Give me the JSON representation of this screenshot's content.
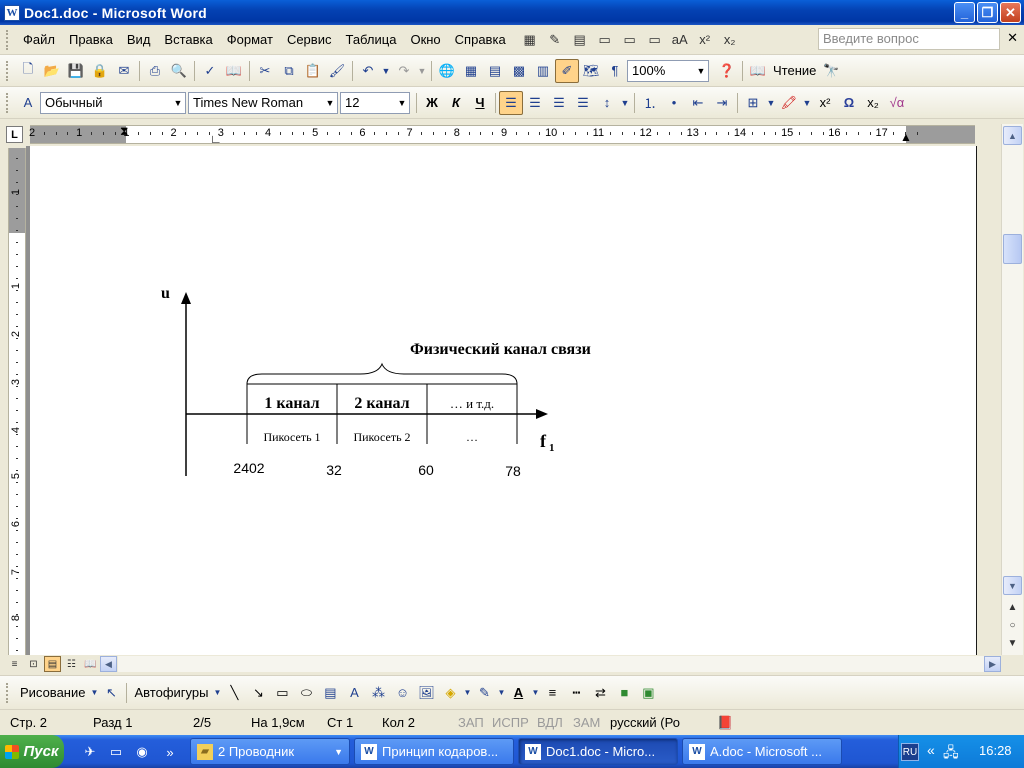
{
  "window": {
    "title": "Doc1.doc - Microsoft Word"
  },
  "menu": {
    "items": [
      "Файл",
      "Правка",
      "Вид",
      "Вставка",
      "Формат",
      "Сервис",
      "Таблица",
      "Окно",
      "Справка"
    ],
    "ask_placeholder": "Введите вопрос"
  },
  "toolbar_standard": {
    "zoom": "100%",
    "reading_label": "Чтение"
  },
  "toolbar_format": {
    "style": "Обычный",
    "font": "Times New Roman",
    "size": "12"
  },
  "ruler": {
    "h_labels": [
      "2",
      "1",
      "1",
      "2",
      "3",
      "4",
      "5",
      "6",
      "7",
      "8",
      "9",
      "10",
      "11",
      "12",
      "13",
      "14",
      "15",
      "16",
      "17"
    ],
    "v_labels": [
      "1",
      "1",
      "2",
      "3",
      "4",
      "5",
      "6",
      "7",
      "8"
    ]
  },
  "diagram": {
    "y_label": "u",
    "x_label": "f",
    "x_label_sub": "1",
    "brace_label": "Физический канал связи",
    "channels": [
      "1 канал",
      "2 канал",
      "… и т.д."
    ],
    "piconets": [
      "Пикосеть 1",
      "Пикосеть 2",
      "…"
    ],
    "freq_labels": [
      "2402",
      "32",
      "60",
      "78"
    ]
  },
  "drawing_toolbar": {
    "draw_label": "Рисование",
    "autoshapes_label": "Автофигуры"
  },
  "status": {
    "page": "Стр. 2",
    "section": "Разд 1",
    "pages": "2/5",
    "at": "На 1,9см",
    "line": "Ст 1",
    "col": "Кол 2",
    "rec": "ЗАП",
    "trk": "ИСПР",
    "ext": "ВДЛ",
    "ovr": "ЗАМ",
    "lang": "русский (Ро"
  },
  "taskbar": {
    "start_label": "Пуск",
    "tasks": [
      "2 Проводник",
      "Принцип кодаров...",
      "Doc1.doc - Micro...",
      "A.doc - Microsoft ..."
    ],
    "tray_lang": "RU",
    "clock": "16:28"
  }
}
